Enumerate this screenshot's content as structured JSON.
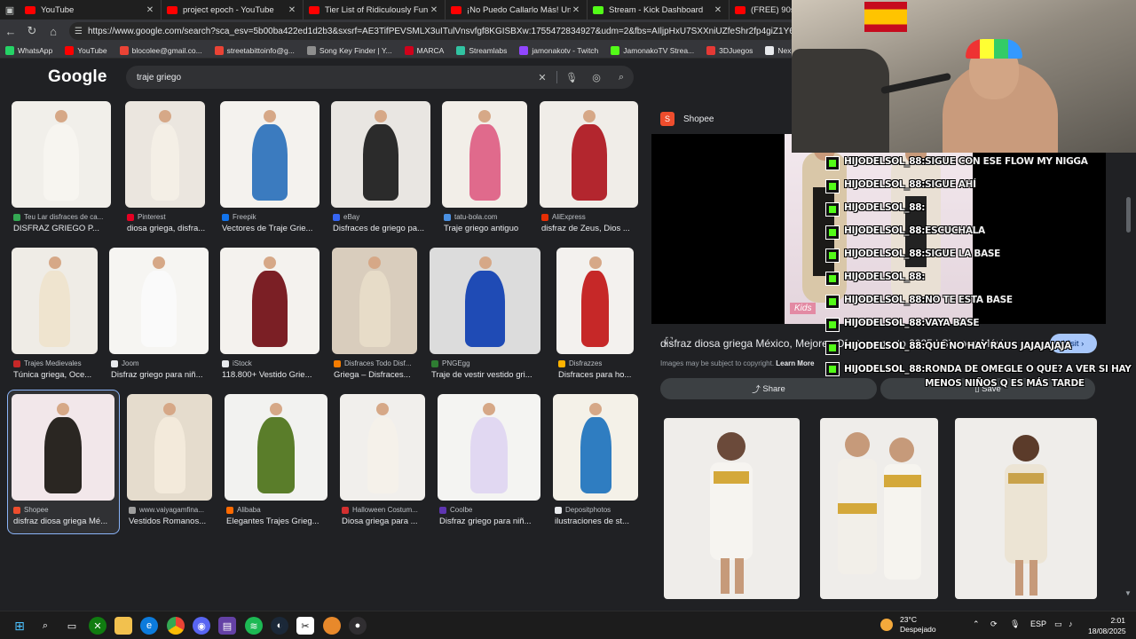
{
  "tabs": [
    {
      "label": "YouTube",
      "icon": "youtube-icon"
    },
    {
      "label": "project epoch - YouTube",
      "icon": "youtube-icon"
    },
    {
      "label": "Tier List of Ridiculously Fun Class",
      "icon": "youtube-icon"
    },
    {
      "label": "¡No Puedo Callarlo Más! Un Exme",
      "icon": "youtube-icon"
    },
    {
      "label": "Stream - Kick Dashboard",
      "icon": "kick-icon"
    },
    {
      "label": "(FREE) 90s Free",
      "icon": "youtube-icon"
    }
  ],
  "address": {
    "url": "https://www.google.com/search?sca_esv=5b00ba422ed1d2b3&sxsrf=AE3TifPEVSMLX3uITulVnsvfgf8KGISBXw:1755472834927&udm=2&fbs=AIljpHxU7SXXniUZfeShr2fp4giZ1Y6MJ25_tmWITc7u"
  },
  "bookmarks": [
    {
      "label": "WhatsApp",
      "color": "#25d366"
    },
    {
      "label": "YouTube",
      "color": "#ff0000"
    },
    {
      "label": "blocolee@gmail.co...",
      "color": "#ea4335"
    },
    {
      "label": "streetabittoinfo@g...",
      "color": "#ea4335"
    },
    {
      "label": "Song Key Finder | Y...",
      "color": "#8e8e8e"
    },
    {
      "label": "MARCA",
      "color": "#d0021b"
    },
    {
      "label": "Streamlabs",
      "color": "#31c3a2"
    },
    {
      "label": "jamonakotv - Twitch",
      "color": "#9146ff"
    },
    {
      "label": "JamonakoTV Strea...",
      "color": "#53fc18"
    },
    {
      "label": "3DJuegos",
      "color": "#e53935"
    },
    {
      "label": "Nexus Clips",
      "color": "#e8eaed"
    }
  ],
  "google": {
    "logo": "Google",
    "query": "traje griego"
  },
  "results": [
    {
      "source": "Teu Lar disfraces de ca...",
      "title": "DISFRAZ GRIEGO P...",
      "fav": "#34a853"
    },
    {
      "source": "Pinterest",
      "title": "diosa griega, disfra...",
      "fav": "#e60023"
    },
    {
      "source": "Freepik",
      "title": "Vectores de Traje Grie...",
      "fav": "#1273eb"
    },
    {
      "source": "eBay",
      "title": "Disfraces de griego pa...",
      "fav": "#3665f3"
    },
    {
      "source": "tatu-bola.com",
      "title": "Traje griego antiguo",
      "fav": "#4a90e2"
    },
    {
      "source": "AliExpress",
      "title": "disfraz de Zeus, Dios ...",
      "fav": "#e62e04"
    },
    {
      "source": "Trajes Medievales",
      "title": "Túnica griega, Oce...",
      "fav": "#c62828"
    },
    {
      "source": "Joom",
      "title": "Disfraz griego para niñ...",
      "fav": "#e8eaed"
    },
    {
      "source": "iStock",
      "title": "118.800+ Vestido Grie...",
      "fav": "#e8eaed"
    },
    {
      "source": "Disfraces Todo Disf...",
      "title": "Griega – Disfraces...",
      "fav": "#f57c00"
    },
    {
      "source": "PNGEgg",
      "title": "Traje de vestir vestido gri...",
      "fav": "#2e7d32"
    },
    {
      "source": "Disfrazzes",
      "title": "Disfraces para ho...",
      "fav": "#ffb300"
    },
    {
      "source": "Shopee",
      "title": "disfraz diosa griega Mé...",
      "fav": "#ee4d2d"
    },
    {
      "source": "www.vaiyagamfina...",
      "title": "Vestidos Romanos...",
      "fav": "#9e9e9e"
    },
    {
      "source": "Alibaba",
      "title": "Elegantes Trajes Grieg...",
      "fav": "#ff6a00"
    },
    {
      "source": "Halloween Costum...",
      "title": "Diosa griega para ...",
      "fav": "#d32f2f"
    },
    {
      "source": "Coolbe",
      "title": "Disfraz griego para niñ...",
      "fav": "#5e35b1"
    },
    {
      "source": "Depositphotos",
      "title": "ilustraciones de st...",
      "fav": "#e8eaed"
    }
  ],
  "preview": {
    "brand": "Shopee",
    "brand_letter": "S",
    "image_tag": "Kids",
    "title": "disfraz diosa griega México, Mejores Ofertas agosto 2025 | Shopee México",
    "visit_label": "Visit",
    "copyright_text": "Images may be subject to copyright.",
    "learn_more": "Learn More",
    "share_label": "Share",
    "save_label": "Save"
  },
  "chat": [
    {
      "user": "HIJODELSOL_88:",
      "text": "SIGUE CON ESE FLOW MY NIGGA"
    },
    {
      "user": "HIJODELSOL_88:",
      "text": "SIGUE AHÍ"
    },
    {
      "user": "HIJODELSOL_88:",
      "text": ""
    },
    {
      "user": "HIJODELSOL_88:",
      "text": "ESCUCHALA"
    },
    {
      "user": "HIJODELSOL_88:",
      "text": "SIGUE LA BASE"
    },
    {
      "user": "HIJODELSOL_88:",
      "text": ""
    },
    {
      "user": "HIJODELSOL_88:",
      "text": "NO TE ESTA BASE"
    },
    {
      "user": "HIJODELSOL_88:",
      "text": "VAYA BASE"
    },
    {
      "user": "HIJODELSOL_88:",
      "text": "QUE NO HAY RAUS JAJAJAJAJA"
    },
    {
      "user": "HIJODELSOL_88:",
      "text": "RONDA DE OMEGLE O QUE? A VER SI HAY MENOS NIÑOS Q ES MÁS TARDE"
    }
  ],
  "taskbar": {
    "temperature": "23°C",
    "weather": "Despejado",
    "language": "ESP",
    "time": "2:01",
    "date": "18/08/2025"
  }
}
